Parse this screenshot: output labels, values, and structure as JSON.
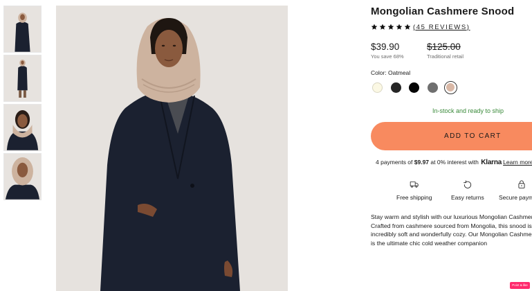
{
  "product": {
    "title": "Mongolian Cashmere Snood",
    "rating": 5,
    "reviews_label": "(45 REVIEWS)",
    "price": "$39.90",
    "savings": "You save 68%",
    "retail_price": "$125.00",
    "retail_label": "Traditional retail",
    "color_label": "Color: Oatmeal",
    "colors": [
      {
        "name": "ivory",
        "hex": "#fbf8e4"
      },
      {
        "name": "charcoal",
        "hex": "#262626"
      },
      {
        "name": "black",
        "hex": "#050505"
      },
      {
        "name": "grey",
        "hex": "#6f6f6f"
      },
      {
        "name": "oatmeal",
        "hex": "#d9b8a6",
        "selected": true
      }
    ],
    "stock_status": "In-stock and ready to ship",
    "add_to_cart_label": "ADD TO CART",
    "klarna": {
      "prefix": "4 payments of ",
      "amount": "$9.97",
      "suffix": " at 0% interest with ",
      "brand": "Klarna",
      "link": "Learn more"
    },
    "features": [
      {
        "icon": "truck-icon",
        "label": "Free shipping"
      },
      {
        "icon": "return-arrow-icon",
        "label": "Easy returns"
      },
      {
        "icon": "lock-icon",
        "label": "Secure payments"
      }
    ],
    "description_lines": [
      "Stay warm and stylish with our luxurious Mongolian Cashmere Snood.",
      "Crafted from cashmere sourced from Mongolia, this snood is",
      "incredibly soft and wonderfully cozy. Our Mongolian Cashmere Snood",
      "is the ultimate chic cold weather companion"
    ]
  },
  "badge_label": "Point & like",
  "colors": {
    "accent": "#f88a5f",
    "stock_green": "#3a8a3a",
    "image_background": "#e6e2de",
    "coat": "#1b2130",
    "snood": "#cdb39f"
  }
}
